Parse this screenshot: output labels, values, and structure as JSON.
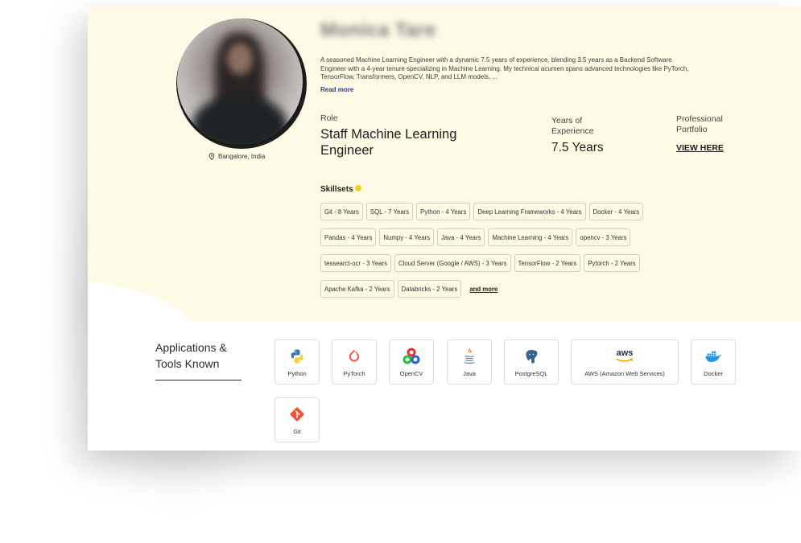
{
  "profile": {
    "name": "Monica Tare",
    "location": "Bangalore, India",
    "bio": "A seasoned Machine Learning Engineer with a dynamic 7.5 years of experience,  blending 3.5 years as a Backend Software Engineer with a 4-year tenure specializing in Machine Learning. My technical acumen spans advanced technologies like PyTorch, TensorFlow, Transformers, OpenCV, NLP, and LLM models, ...",
    "read_more_label": "Read more",
    "role_label": "Role",
    "role_value": "Staff Machine Learning Engineer",
    "experience_label": "Years of Experience",
    "experience_value": "7.5 Years",
    "portfolio_label": "Professional Portfolio",
    "portfolio_link": "VIEW HERE"
  },
  "skills": {
    "title": "Skillsets",
    "rows": [
      [
        "Git - 8 Years",
        "SQL - 7 Years",
        "Python - 4 Years",
        "Deep Learning Frameworks - 4 Years",
        "Docker - 4 Years"
      ],
      [
        "Pandas - 4 Years",
        "Numpy - 4 Years",
        "Java - 4 Years",
        "Machine Learning - 4 Years",
        "opencv - 3 Years"
      ],
      [
        "tessearct-ocr - 3 Years",
        "Cloud Server (Google / AWS) - 3 Years",
        "TensorFlow - 2 Years",
        "Pytorch - 2 Years"
      ],
      [
        "Apache Kafka - 2 Years",
        "Databricks - 2 Years"
      ]
    ],
    "and_more_label": "and more"
  },
  "apps": {
    "title": "Applications & Tools Known",
    "tools": [
      {
        "label": "Python",
        "icon": "python-icon"
      },
      {
        "label": "PyTorch",
        "icon": "pytorch-icon"
      },
      {
        "label": "OpenCV",
        "icon": "opencv-icon"
      },
      {
        "label": "Java",
        "icon": "java-icon"
      },
      {
        "label": "PostgreSQL",
        "icon": "postgresql-icon"
      },
      {
        "label": "AWS (Amazon Web Services)",
        "icon": "aws-icon",
        "logo_text": "aws"
      },
      {
        "label": "Docker",
        "icon": "docker-icon"
      },
      {
        "label": "Git",
        "icon": "git-icon"
      }
    ]
  },
  "colors": {
    "hero_background": "#fdfbe6",
    "accent_dot": "#f4cf1f",
    "read_more": "#2d3b8a"
  }
}
